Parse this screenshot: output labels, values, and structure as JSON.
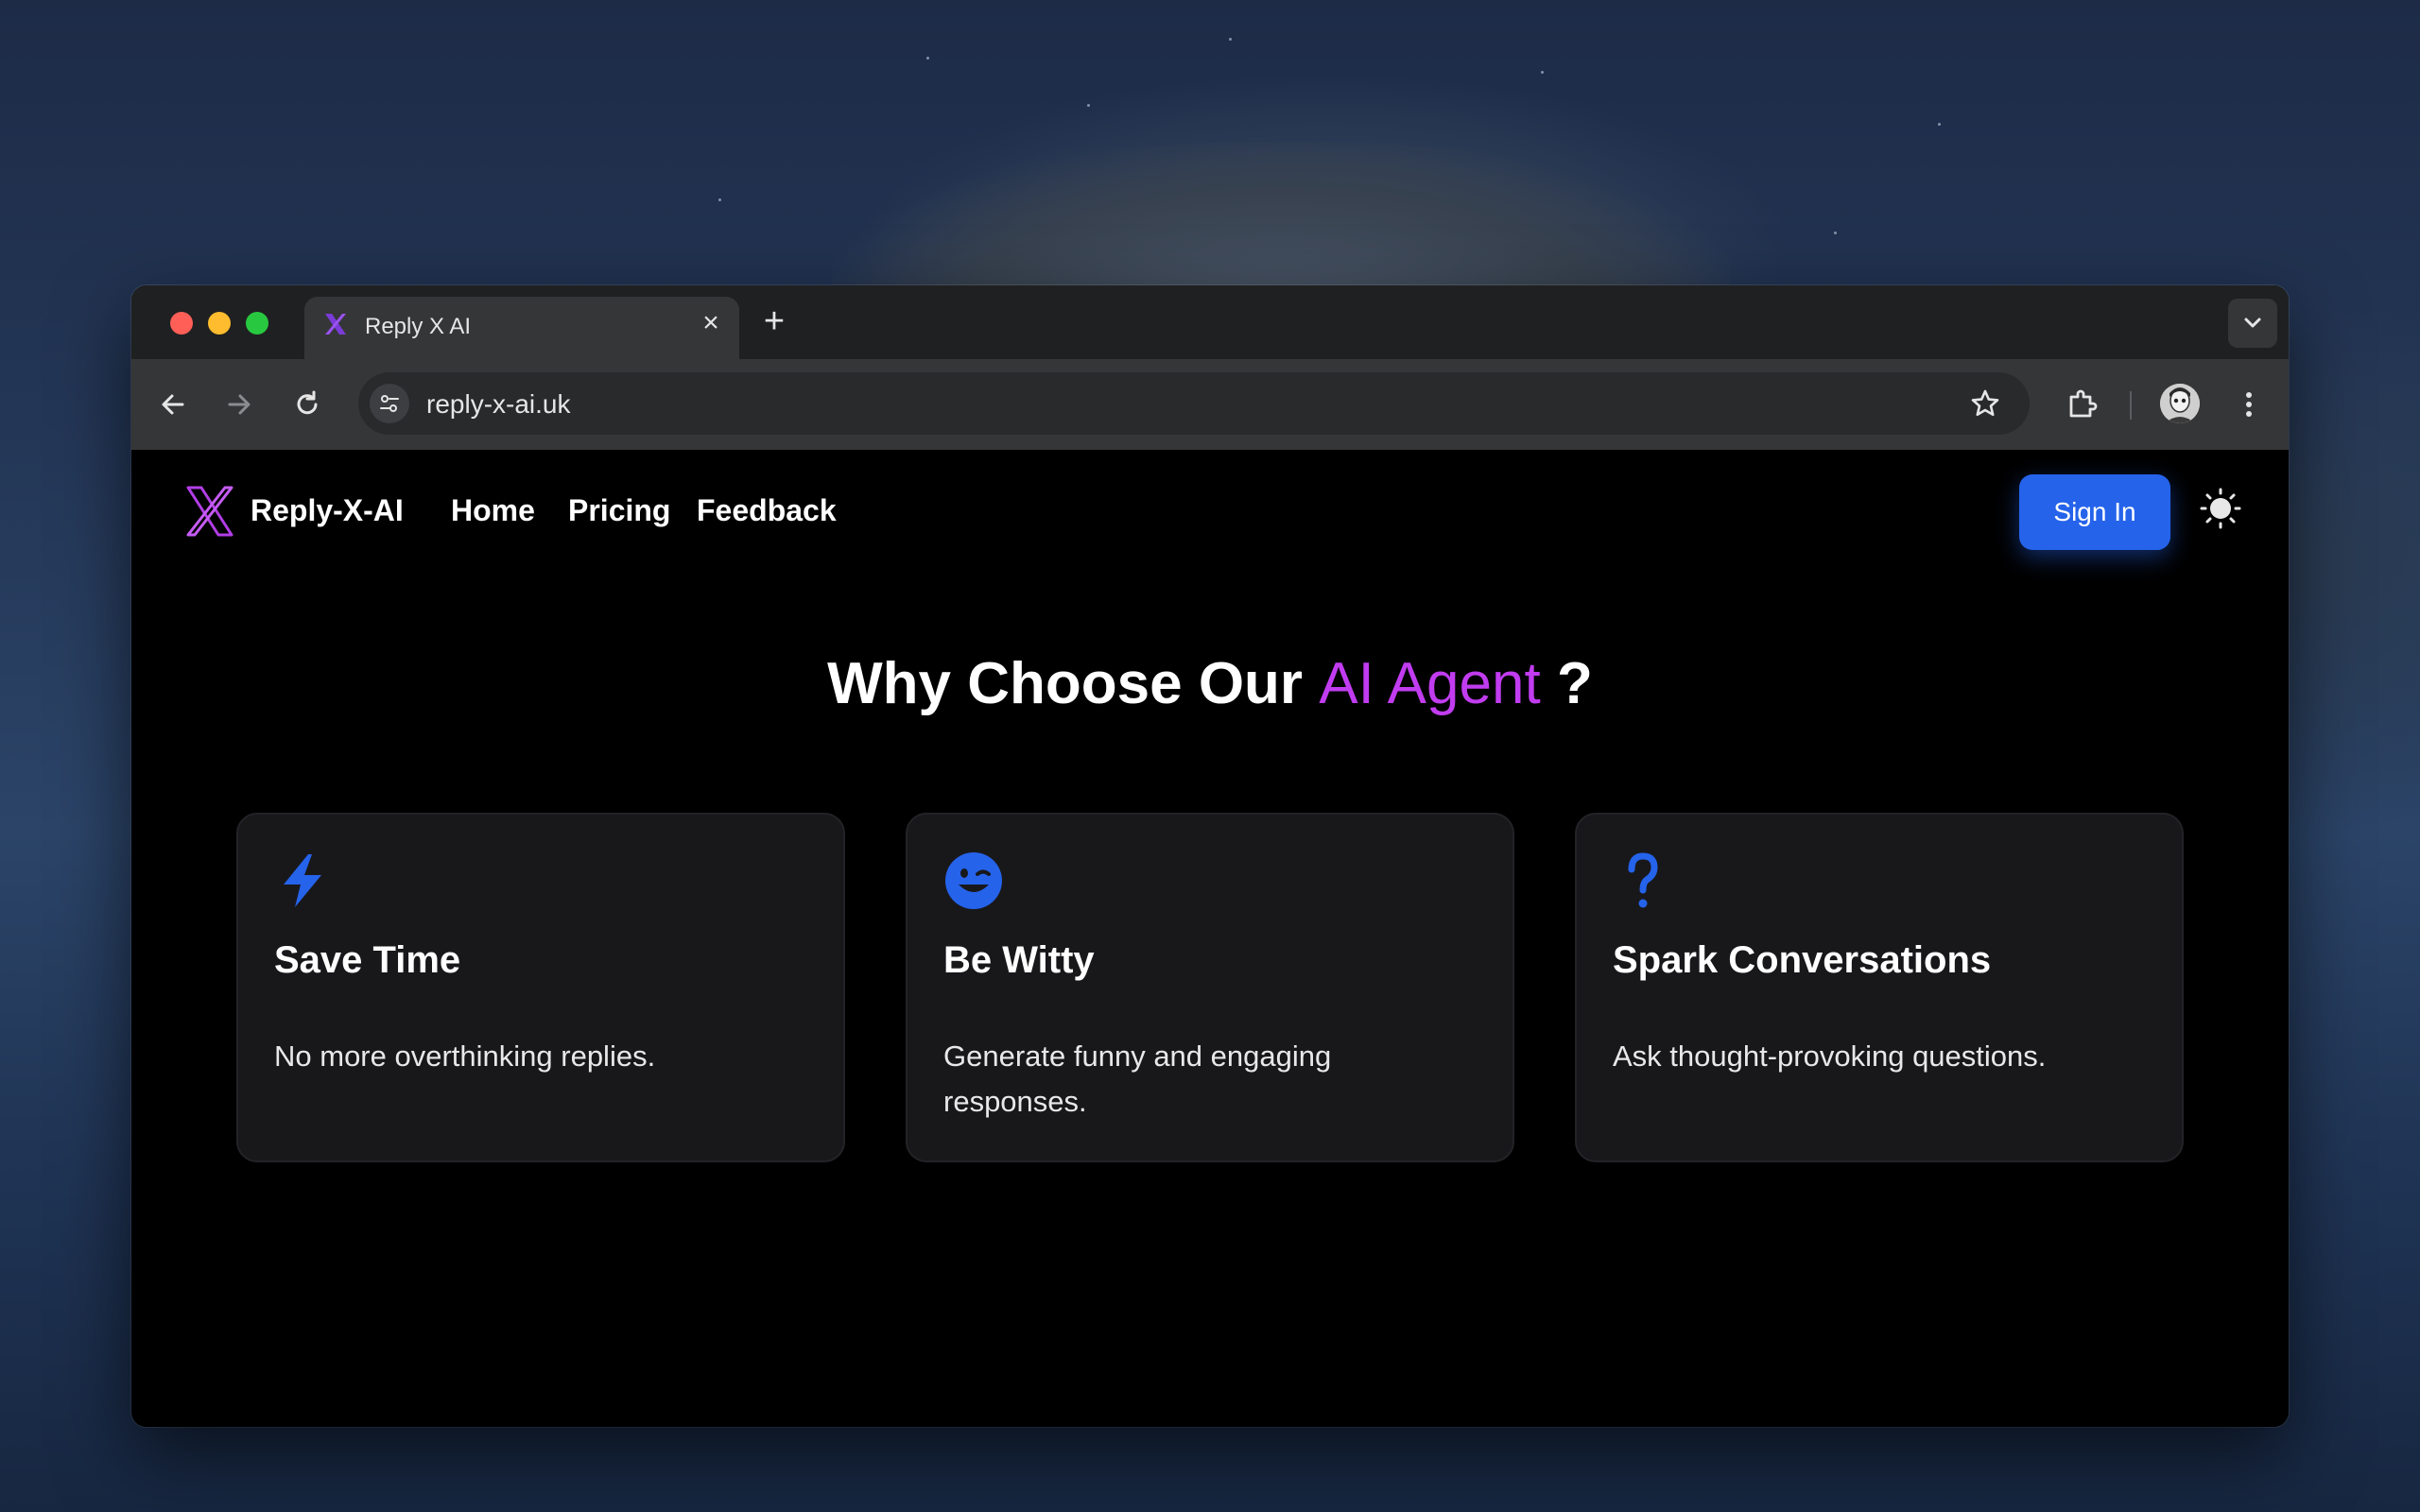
{
  "browser": {
    "tab_title": "Reply X AI",
    "new_tab_symbol": "+",
    "close_symbol": "×",
    "url": "reply-x-ai.uk"
  },
  "nav": {
    "brand": "Reply-X-AI",
    "links": [
      "Home",
      "Pricing",
      "Feedback"
    ],
    "sign_in": "Sign In"
  },
  "hero": {
    "heading_prefix": "Why Choose Our ",
    "heading_accent": "AI Agent",
    "heading_suffix": " ?"
  },
  "features": [
    {
      "icon": "lightning-icon",
      "title": "Save Time",
      "description": "No more overthinking replies."
    },
    {
      "icon": "wink-face-icon",
      "title": "Be Witty",
      "description": "Generate funny and engaging responses."
    },
    {
      "icon": "question-mark-icon",
      "title": "Spark Conversations",
      "description": "Ask thought-provoking questions."
    }
  ],
  "colors": {
    "accent_purple": "#c13cf0",
    "primary_blue": "#2563eb",
    "card_bg": "#18181b",
    "page_bg": "#000000"
  }
}
